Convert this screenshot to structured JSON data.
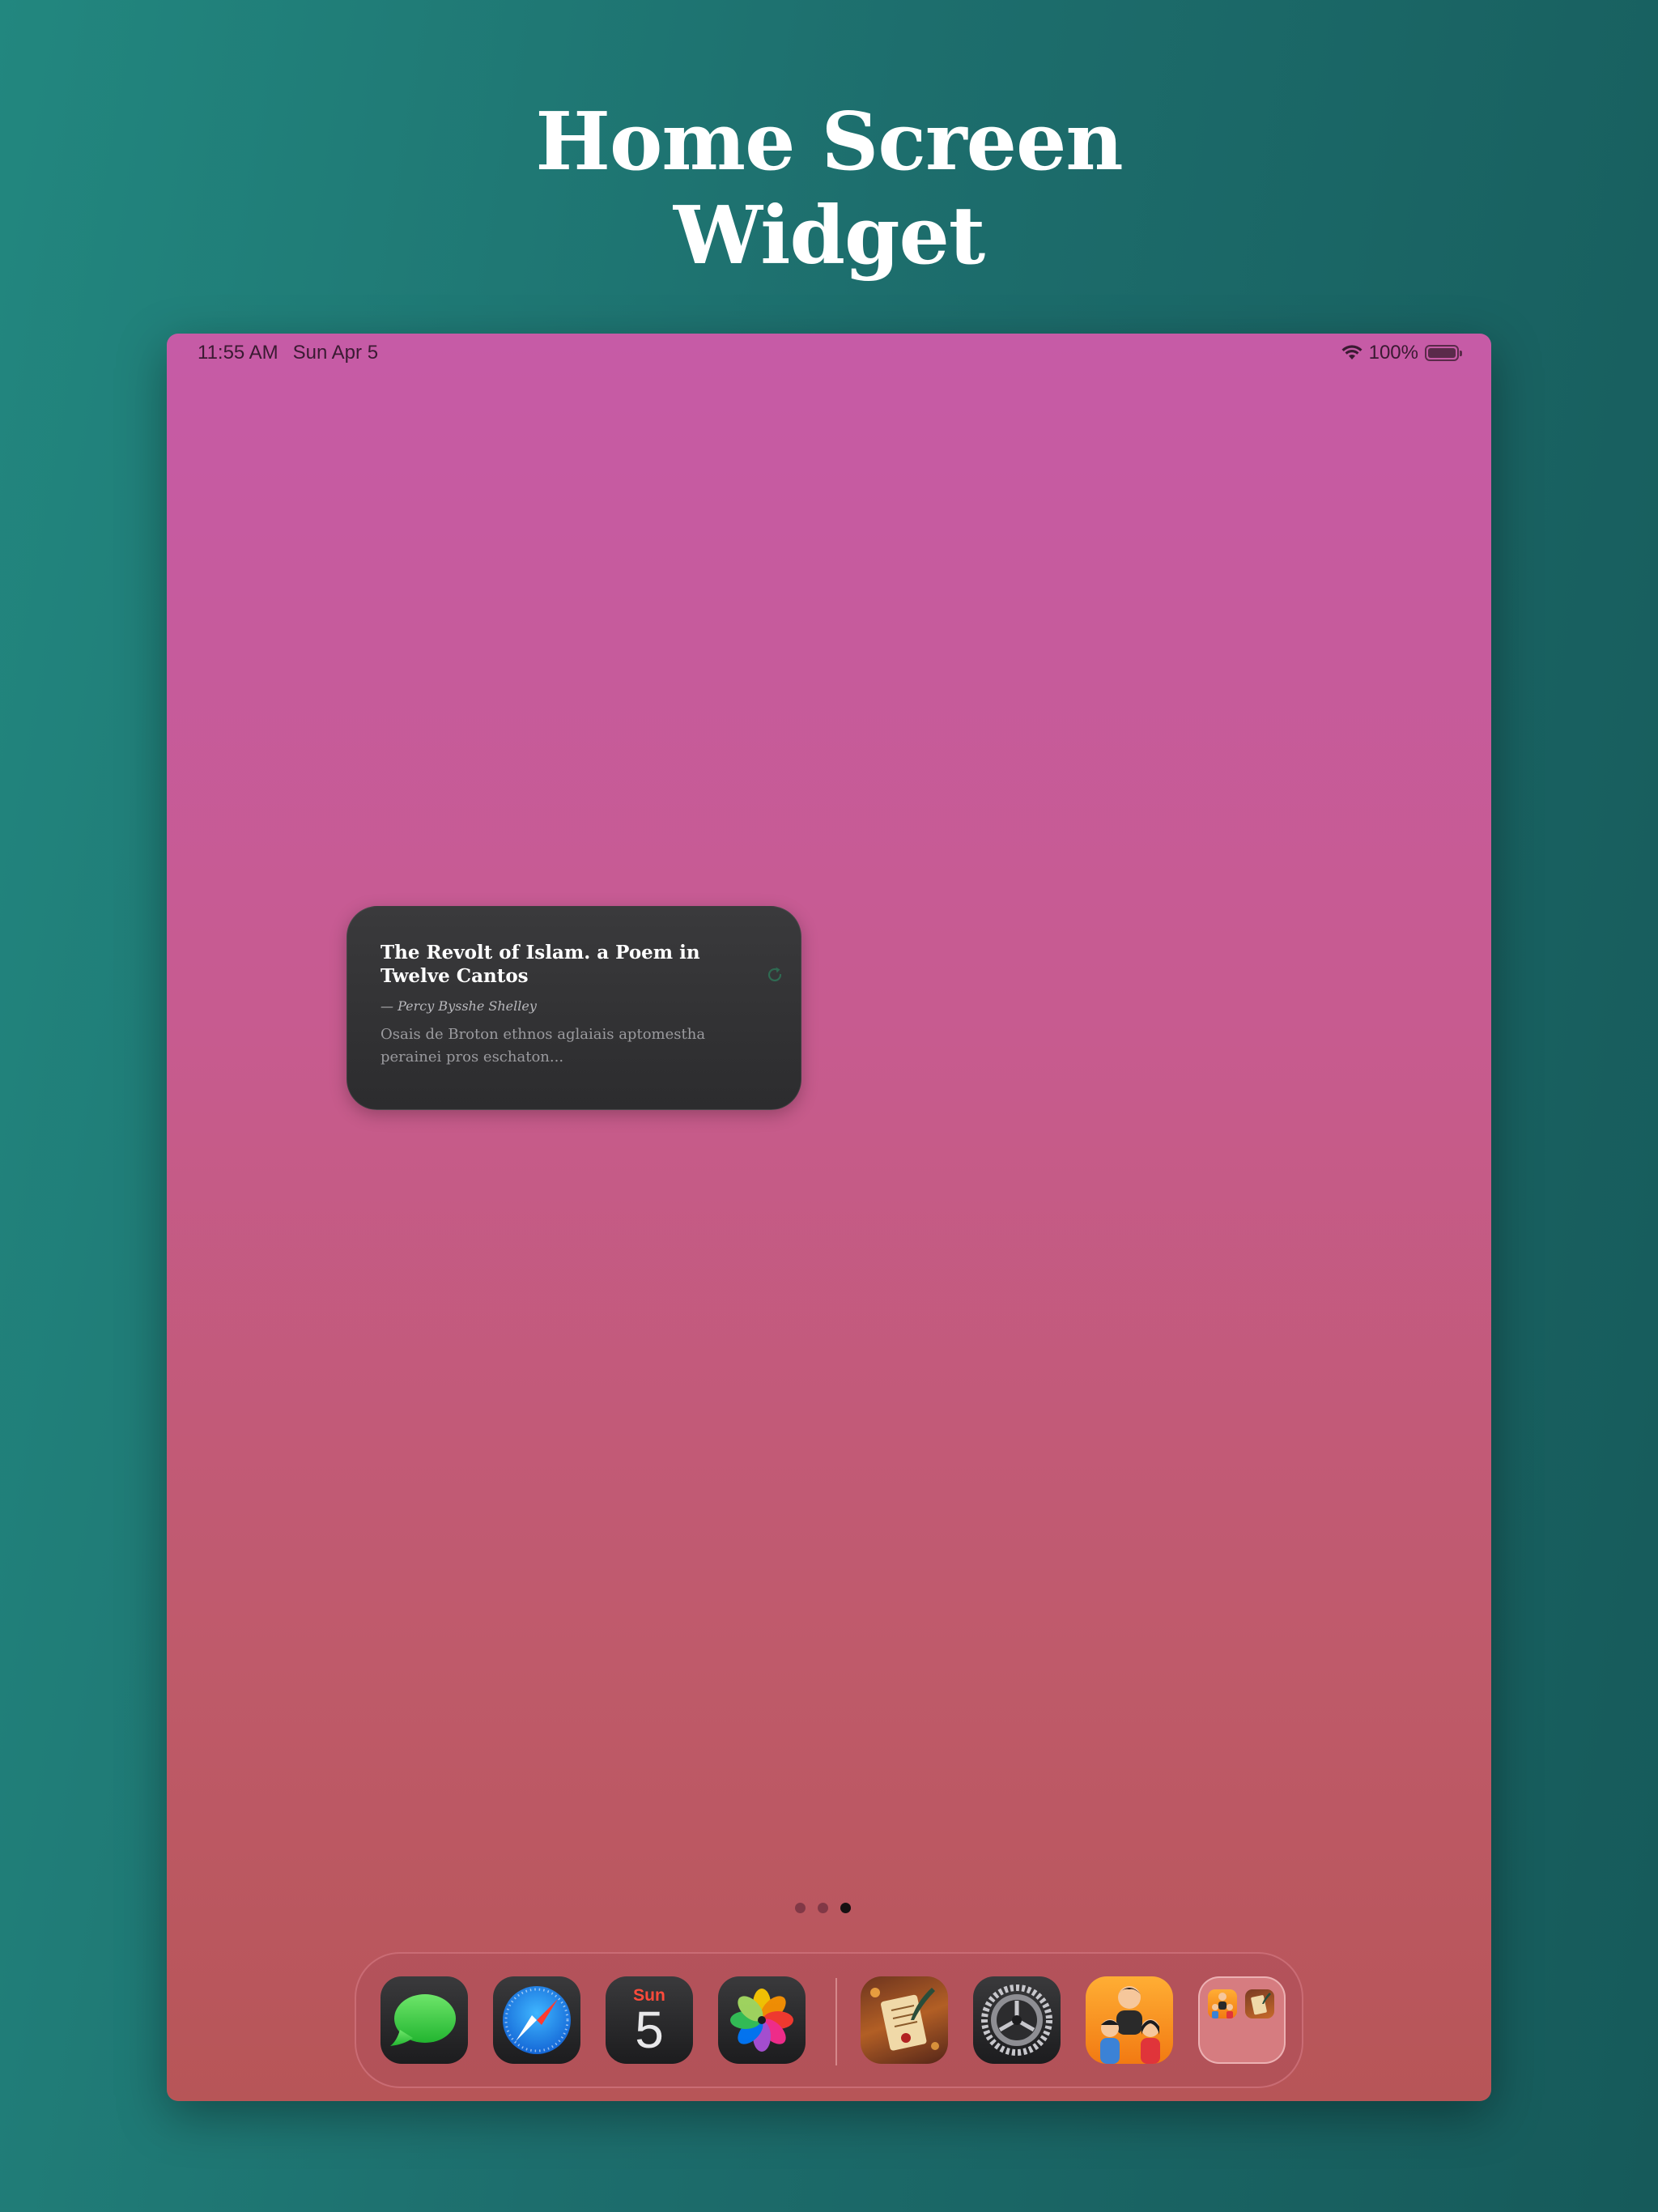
{
  "headline": {
    "line1": "Home Screen",
    "line2": "Widget"
  },
  "status_bar": {
    "time": "11:55 AM",
    "date": "Sun Apr 5",
    "battery": "100%",
    "battery_level": 1.0
  },
  "widget": {
    "title": "The Revolt of Islam. a Poem in Twelve Cantos",
    "author": "— Percy Bysshe Shelley",
    "excerpt": "Osais de Broton ethnos aglaiais aptomestha perainei pros eschaton...",
    "icon": "refresh-icon"
  },
  "page_indicator": {
    "count": 3,
    "active_index": 2
  },
  "dock": {
    "apps": [
      {
        "name": "Messages",
        "icon": "messages-icon"
      },
      {
        "name": "Safari",
        "icon": "safari-icon"
      },
      {
        "name": "Calendar",
        "icon": "calendar-icon",
        "day": "Sun",
        "date": "5"
      },
      {
        "name": "Photos",
        "icon": "photos-icon"
      },
      {
        "name": "Poetry",
        "icon": "scroll-quill-icon"
      },
      {
        "name": "Settings",
        "icon": "gear-icon"
      },
      {
        "name": "Family",
        "icon": "family-icon"
      },
      {
        "name": "Folder",
        "icon": "folder-icon"
      }
    ]
  },
  "colors": {
    "background": "#1d6e6d",
    "wallpaper_top": "#c65ba6",
    "wallpaper_bottom": "#b75557",
    "widget_bg": "#2c2c2e",
    "calendar_red": "#ff4b3b"
  }
}
